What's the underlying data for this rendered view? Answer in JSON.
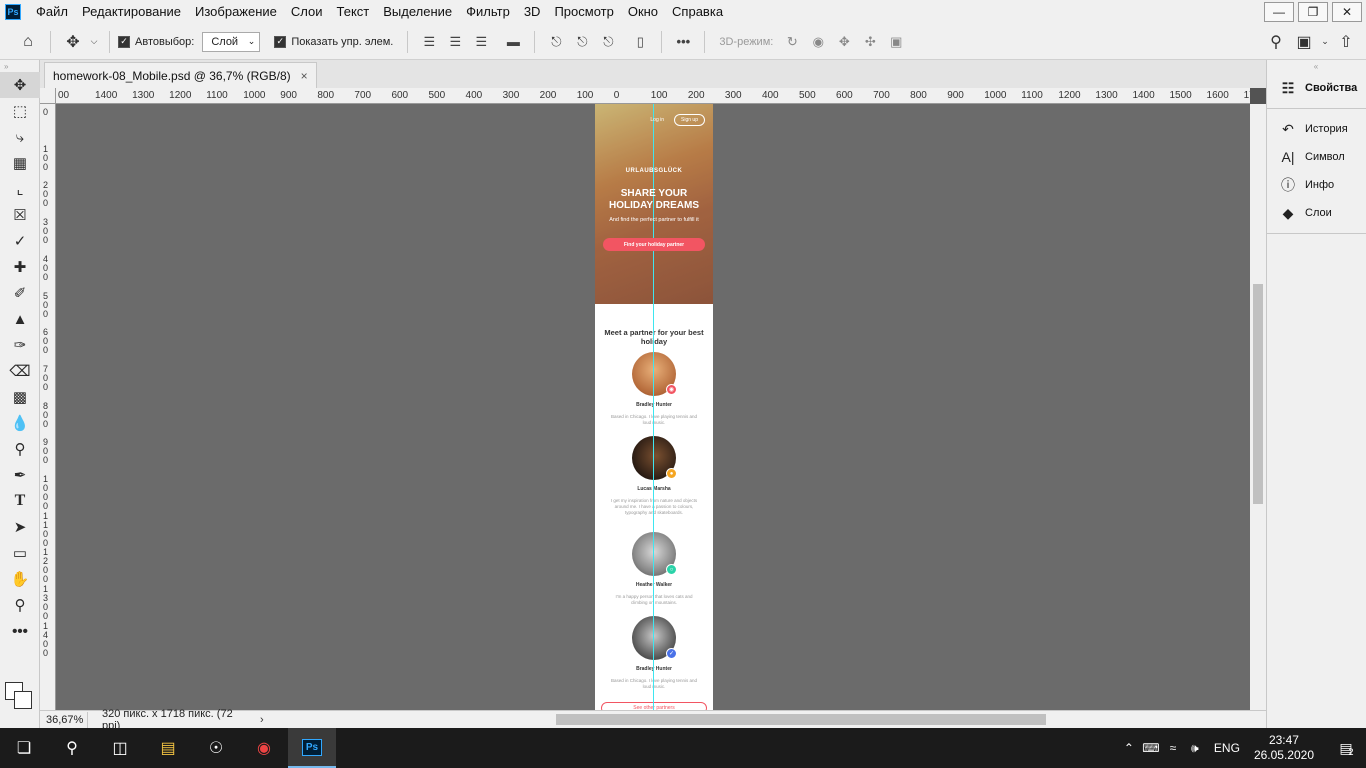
{
  "app": {
    "logo": "Ps",
    "menu": [
      "Файл",
      "Редактирование",
      "Изображение",
      "Слои",
      "Текст",
      "Выделение",
      "Фильтр",
      "3D",
      "Просмотр",
      "Окно",
      "Справка"
    ]
  },
  "options": {
    "auto_select_label": "Автовыбор:",
    "auto_select_value": "Слой",
    "show_controls_label": "Показать упр. элем.",
    "mode_3d_label": "3D-режим:"
  },
  "document": {
    "tab_title": "homework-08_Mobile.psd @ 36,7% (RGB/8)",
    "close_glyph": "×"
  },
  "ruler": {
    "top_labels": [
      "00",
      "1400",
      "1300",
      "1200",
      "1100",
      "1000",
      "900",
      "800",
      "700",
      "600",
      "500",
      "400",
      "300",
      "200",
      "100",
      "0",
      "100",
      "200",
      "300",
      "400",
      "500",
      "600",
      "700",
      "800",
      "900",
      "1000",
      "1100",
      "1200",
      "1300",
      "1400",
      "1500",
      "1600",
      "1700"
    ],
    "left_labels": [
      "0",
      "100",
      "200",
      "300",
      "400",
      "500",
      "600",
      "700",
      "800",
      "900",
      "1000",
      "1100",
      "1200",
      "1300",
      "1400"
    ]
  },
  "artboard": {
    "nav_login": "Log in",
    "nav_signup": "Sign up",
    "brand": "URLAUBSGLÜCK",
    "hero_title": "SHARE YOUR HOLIDAY DREAMS",
    "hero_sub": "And find the perfect partner to fulfill it",
    "hero_cta": "Find your holiday partner",
    "section_title": "Meet a partner for your best holiday",
    "partners": [
      {
        "name": "Bradley Hunter",
        "desc": "Based in Chicago. I love playing tennis and loud music.",
        "badge_color": "#f25562"
      },
      {
        "name": "Lucas Marsha",
        "desc": "I get my inspiration from nature and objects around me. I have a passion to colours, typography and skateboards.",
        "badge_color": "#f5a623"
      },
      {
        "name": "Heather Walker",
        "desc": "I'm a happy person that loves cats and climbing on mountains.",
        "badge_color": "#2bd3a9"
      },
      {
        "name": "Bradley Hunter",
        "desc": "Based in Chicago. I love playing tennis and loud music.",
        "badge_color": "#4a72e8"
      }
    ],
    "see_other": "See other partners"
  },
  "panels": {
    "properties": "Свойства",
    "history": "История",
    "character": "Символ",
    "info": "Инфо",
    "layers": "Слои"
  },
  "status": {
    "zoom": "36,67%",
    "doc_info": "320 пикс. x 1718 пикс. (72 ppi)",
    "arrow": "›"
  },
  "taskbar": {
    "lang": "ENG",
    "time": "23:47",
    "date": "26.05.2020",
    "notifications": "2"
  }
}
